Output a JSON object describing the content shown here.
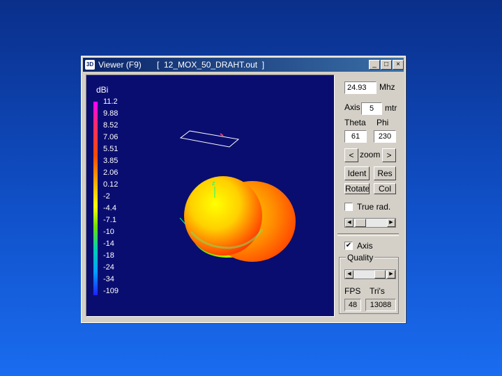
{
  "window": {
    "title": "Viewer (F9)",
    "file": "[  12_MOX_50_DRAHT.out  ]",
    "app_icon_text": "3D",
    "minimize_glyph": "_",
    "maximize_glyph": "□",
    "close_glyph": "×"
  },
  "legend": {
    "unit": "dBi",
    "labels": [
      "11.2",
      "9.88",
      "8.52",
      "7.06",
      "5.51",
      "3.85",
      "2.06",
      "0.12",
      "-2",
      "-4.4",
      "-7.1",
      "-10",
      "-14",
      "-18",
      "-24",
      "-34",
      "-109"
    ]
  },
  "plot": {
    "z_axis_label": "z",
    "pattern_colors": [
      "#ffff00",
      "#ffae00",
      "#ff4a00",
      "#74e000",
      "#00d0b0"
    ],
    "antenna_color": "#ffffff",
    "background": "#0a0d70"
  },
  "controls": {
    "frequency_value": "24.93",
    "frequency_unit": "Mhz",
    "axis_label": "Axis",
    "axis_value": "5",
    "axis_unit": "mtr",
    "theta_label": "Theta",
    "phi_label": "Phi",
    "theta_value": "61",
    "phi_value": "230",
    "zoom_left": "<",
    "zoom_label": "zoom",
    "zoom_right": ">",
    "ident_label": "Ident",
    "res_label": "Res",
    "rotate_label": "Rotate",
    "col_label": "Col",
    "true_rad_label": "True rad.",
    "true_rad_checked": "",
    "axis_check_label": "Axis",
    "axis_checked": "✔",
    "quality_label": "Quality",
    "slider_left": "◀",
    "slider_right": "▶",
    "fps_label": "FPS",
    "tris_label": "Tri's",
    "fps_value": "48",
    "tris_value": "13088"
  }
}
